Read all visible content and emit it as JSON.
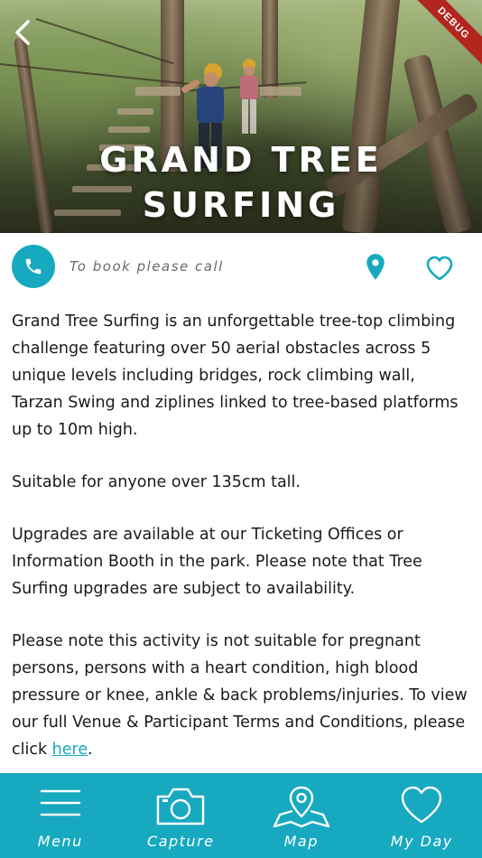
{
  "hero": {
    "title_line1": "GRAND TREE",
    "title_line2": "SURFING",
    "debug_label": "DEBUG"
  },
  "actions": {
    "call_text": "To book please call",
    "accent": "#17a9bf"
  },
  "content": {
    "p1": "Grand Tree Surfing is an unforgettable tree-top climbing challenge featuring over 50 aerial obstacles across 5 unique levels including bridges, rock climbing wall, Tarzan Swing and ziplines linked to tree-based platforms up to 10m high.",
    "p2": "Suitable for anyone over 135cm tall.",
    "p3": "Upgrades are available at our Ticketing Offices or Information Booth in the park. Please note that Tree Surfing upgrades are subject to availability.",
    "p4_prefix": "Please note this activity is not suitable for pregnant persons, persons with a heart condition, high blood pressure or knee, ankle & back problems/injuries. To view our full Venue & Participant Terms and Conditions, please click ",
    "p4_link": "here",
    "p4_suffix": "."
  },
  "tabbar": {
    "tabs": [
      {
        "label": "Menu",
        "icon": "hamburger-icon"
      },
      {
        "label": "Capture",
        "icon": "camera-icon"
      },
      {
        "label": "Map",
        "icon": "map-icon"
      },
      {
        "label": "My Day",
        "icon": "heart-icon"
      }
    ]
  }
}
